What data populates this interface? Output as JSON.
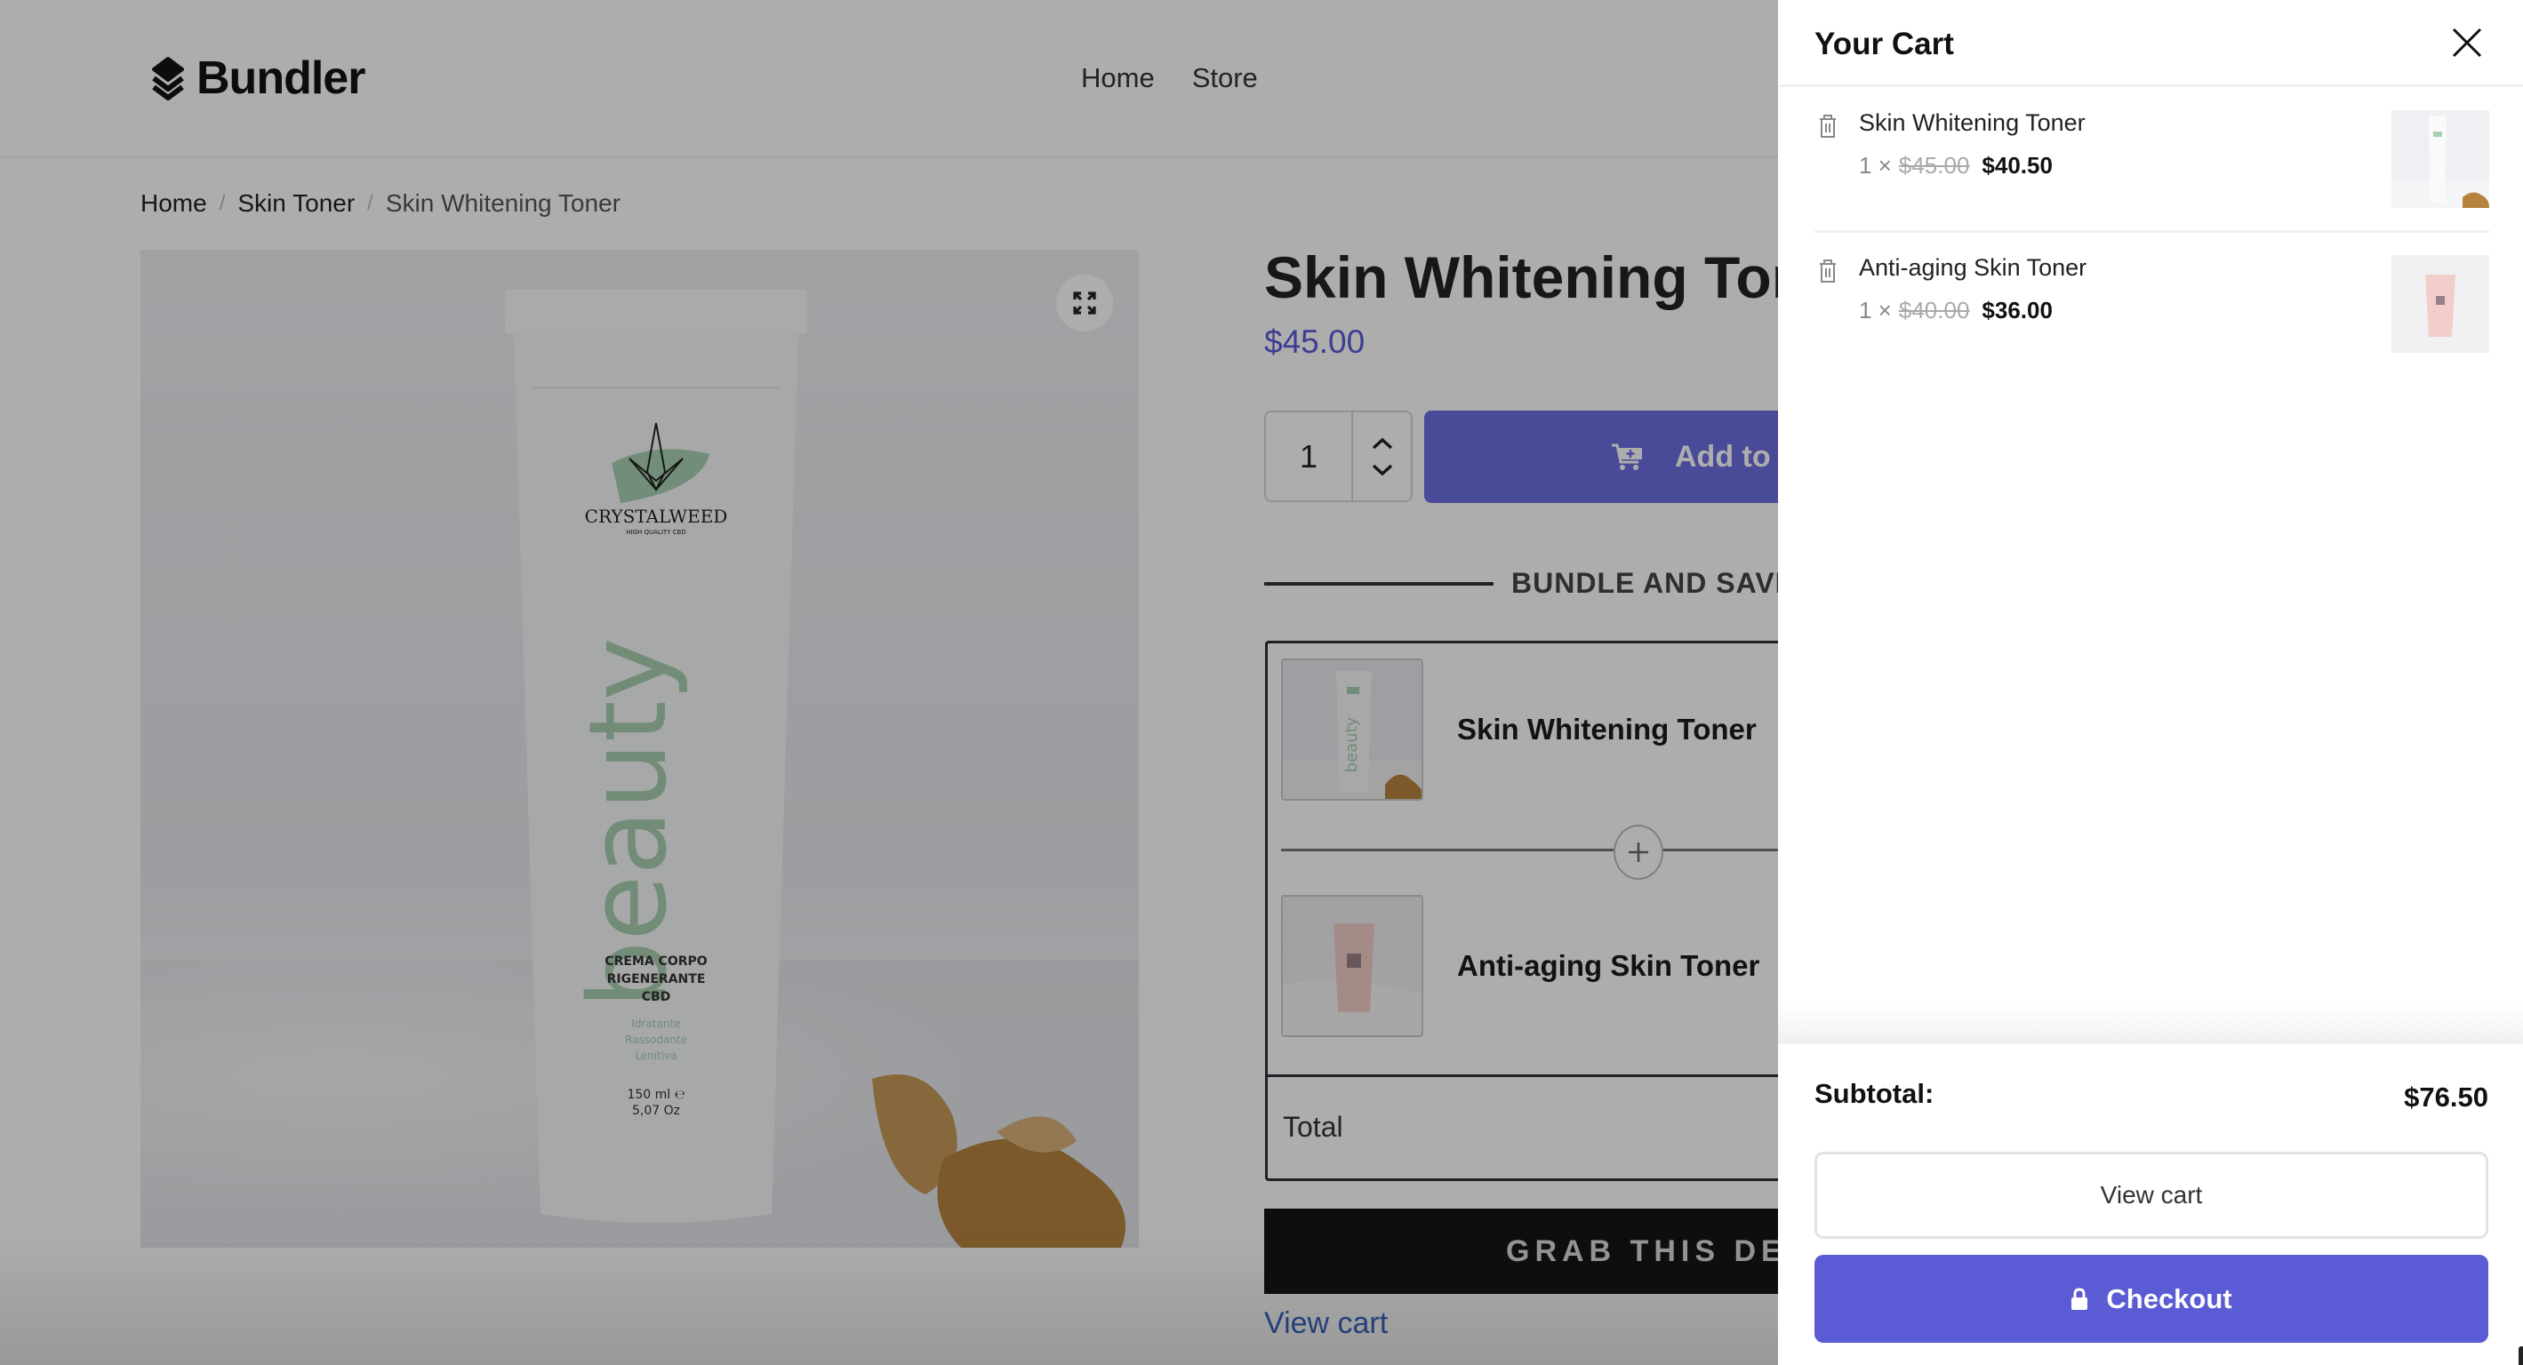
{
  "site": {
    "brand": "Bundler",
    "nav": [
      {
        "label": "Home"
      },
      {
        "label": "Store"
      }
    ]
  },
  "breadcrumb": [
    {
      "label": "Home"
    },
    {
      "label": "Skin Toner"
    },
    {
      "label": "Skin Whitening Toner"
    }
  ],
  "breadcrumb_separator": "/",
  "product": {
    "title": "Skin Whitening Toner",
    "price": "$45.00",
    "quantity": "1",
    "add_to_cart_label": "Add to cart",
    "image_icon": "expand-icon"
  },
  "bundle": {
    "heading": "BUNDLE AND SAVE",
    "items": [
      {
        "name": "Skin Whitening Toner"
      },
      {
        "name": "Anti-aging Skin Toner"
      }
    ],
    "total_label": "Total",
    "cta_label": "GRAB THIS DEAL",
    "view_cart_label": "View cart"
  },
  "cart": {
    "title": "Your Cart",
    "items": [
      {
        "name": "Skin Whitening Toner",
        "qty": "1 ×",
        "original_price": "$45.00",
        "price": "$40.50"
      },
      {
        "name": "Anti-aging Skin Toner",
        "qty": "1 ×",
        "original_price": "$40.00",
        "price": "$36.00"
      }
    ],
    "subtotal_label": "Subtotal:",
    "subtotal_value": "$76.50",
    "view_cart_label": "View cart",
    "checkout_label": "Checkout"
  },
  "colors": {
    "accent": "#5a5bd5",
    "link": "#3a67c0",
    "deal_button": "#151515"
  }
}
